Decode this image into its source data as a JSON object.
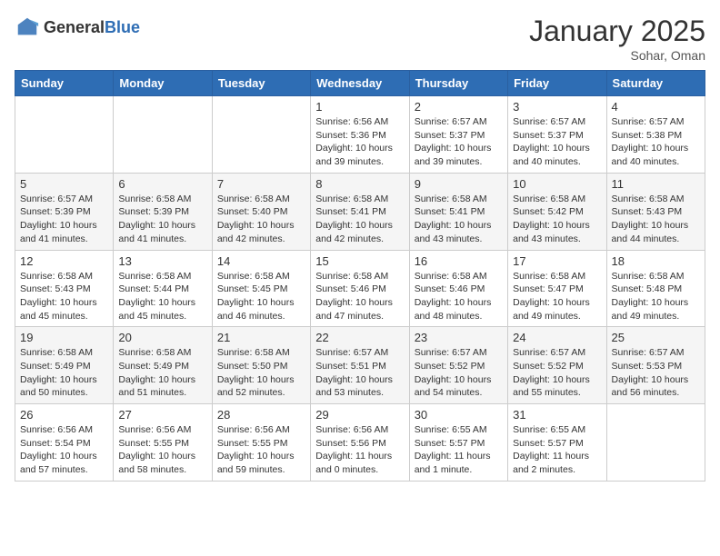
{
  "header": {
    "logo_general": "General",
    "logo_blue": "Blue",
    "month": "January 2025",
    "location": "Sohar, Oman"
  },
  "days_of_week": [
    "Sunday",
    "Monday",
    "Tuesday",
    "Wednesday",
    "Thursday",
    "Friday",
    "Saturday"
  ],
  "weeks": [
    [
      {
        "day": "",
        "content": ""
      },
      {
        "day": "",
        "content": ""
      },
      {
        "day": "",
        "content": ""
      },
      {
        "day": "1",
        "content": "Sunrise: 6:56 AM\nSunset: 5:36 PM\nDaylight: 10 hours\nand 39 minutes."
      },
      {
        "day": "2",
        "content": "Sunrise: 6:57 AM\nSunset: 5:37 PM\nDaylight: 10 hours\nand 39 minutes."
      },
      {
        "day": "3",
        "content": "Sunrise: 6:57 AM\nSunset: 5:37 PM\nDaylight: 10 hours\nand 40 minutes."
      },
      {
        "day": "4",
        "content": "Sunrise: 6:57 AM\nSunset: 5:38 PM\nDaylight: 10 hours\nand 40 minutes."
      }
    ],
    [
      {
        "day": "5",
        "content": "Sunrise: 6:57 AM\nSunset: 5:39 PM\nDaylight: 10 hours\nand 41 minutes."
      },
      {
        "day": "6",
        "content": "Sunrise: 6:58 AM\nSunset: 5:39 PM\nDaylight: 10 hours\nand 41 minutes."
      },
      {
        "day": "7",
        "content": "Sunrise: 6:58 AM\nSunset: 5:40 PM\nDaylight: 10 hours\nand 42 minutes."
      },
      {
        "day": "8",
        "content": "Sunrise: 6:58 AM\nSunset: 5:41 PM\nDaylight: 10 hours\nand 42 minutes."
      },
      {
        "day": "9",
        "content": "Sunrise: 6:58 AM\nSunset: 5:41 PM\nDaylight: 10 hours\nand 43 minutes."
      },
      {
        "day": "10",
        "content": "Sunrise: 6:58 AM\nSunset: 5:42 PM\nDaylight: 10 hours\nand 43 minutes."
      },
      {
        "day": "11",
        "content": "Sunrise: 6:58 AM\nSunset: 5:43 PM\nDaylight: 10 hours\nand 44 minutes."
      }
    ],
    [
      {
        "day": "12",
        "content": "Sunrise: 6:58 AM\nSunset: 5:43 PM\nDaylight: 10 hours\nand 45 minutes."
      },
      {
        "day": "13",
        "content": "Sunrise: 6:58 AM\nSunset: 5:44 PM\nDaylight: 10 hours\nand 45 minutes."
      },
      {
        "day": "14",
        "content": "Sunrise: 6:58 AM\nSunset: 5:45 PM\nDaylight: 10 hours\nand 46 minutes."
      },
      {
        "day": "15",
        "content": "Sunrise: 6:58 AM\nSunset: 5:46 PM\nDaylight: 10 hours\nand 47 minutes."
      },
      {
        "day": "16",
        "content": "Sunrise: 6:58 AM\nSunset: 5:46 PM\nDaylight: 10 hours\nand 48 minutes."
      },
      {
        "day": "17",
        "content": "Sunrise: 6:58 AM\nSunset: 5:47 PM\nDaylight: 10 hours\nand 49 minutes."
      },
      {
        "day": "18",
        "content": "Sunrise: 6:58 AM\nSunset: 5:48 PM\nDaylight: 10 hours\nand 49 minutes."
      }
    ],
    [
      {
        "day": "19",
        "content": "Sunrise: 6:58 AM\nSunset: 5:49 PM\nDaylight: 10 hours\nand 50 minutes."
      },
      {
        "day": "20",
        "content": "Sunrise: 6:58 AM\nSunset: 5:49 PM\nDaylight: 10 hours\nand 51 minutes."
      },
      {
        "day": "21",
        "content": "Sunrise: 6:58 AM\nSunset: 5:50 PM\nDaylight: 10 hours\nand 52 minutes."
      },
      {
        "day": "22",
        "content": "Sunrise: 6:57 AM\nSunset: 5:51 PM\nDaylight: 10 hours\nand 53 minutes."
      },
      {
        "day": "23",
        "content": "Sunrise: 6:57 AM\nSunset: 5:52 PM\nDaylight: 10 hours\nand 54 minutes."
      },
      {
        "day": "24",
        "content": "Sunrise: 6:57 AM\nSunset: 5:52 PM\nDaylight: 10 hours\nand 55 minutes."
      },
      {
        "day": "25",
        "content": "Sunrise: 6:57 AM\nSunset: 5:53 PM\nDaylight: 10 hours\nand 56 minutes."
      }
    ],
    [
      {
        "day": "26",
        "content": "Sunrise: 6:56 AM\nSunset: 5:54 PM\nDaylight: 10 hours\nand 57 minutes."
      },
      {
        "day": "27",
        "content": "Sunrise: 6:56 AM\nSunset: 5:55 PM\nDaylight: 10 hours\nand 58 minutes."
      },
      {
        "day": "28",
        "content": "Sunrise: 6:56 AM\nSunset: 5:55 PM\nDaylight: 10 hours\nand 59 minutes."
      },
      {
        "day": "29",
        "content": "Sunrise: 6:56 AM\nSunset: 5:56 PM\nDaylight: 11 hours\nand 0 minutes."
      },
      {
        "day": "30",
        "content": "Sunrise: 6:55 AM\nSunset: 5:57 PM\nDaylight: 11 hours\nand 1 minute."
      },
      {
        "day": "31",
        "content": "Sunrise: 6:55 AM\nSunset: 5:57 PM\nDaylight: 11 hours\nand 2 minutes."
      },
      {
        "day": "",
        "content": ""
      }
    ]
  ]
}
